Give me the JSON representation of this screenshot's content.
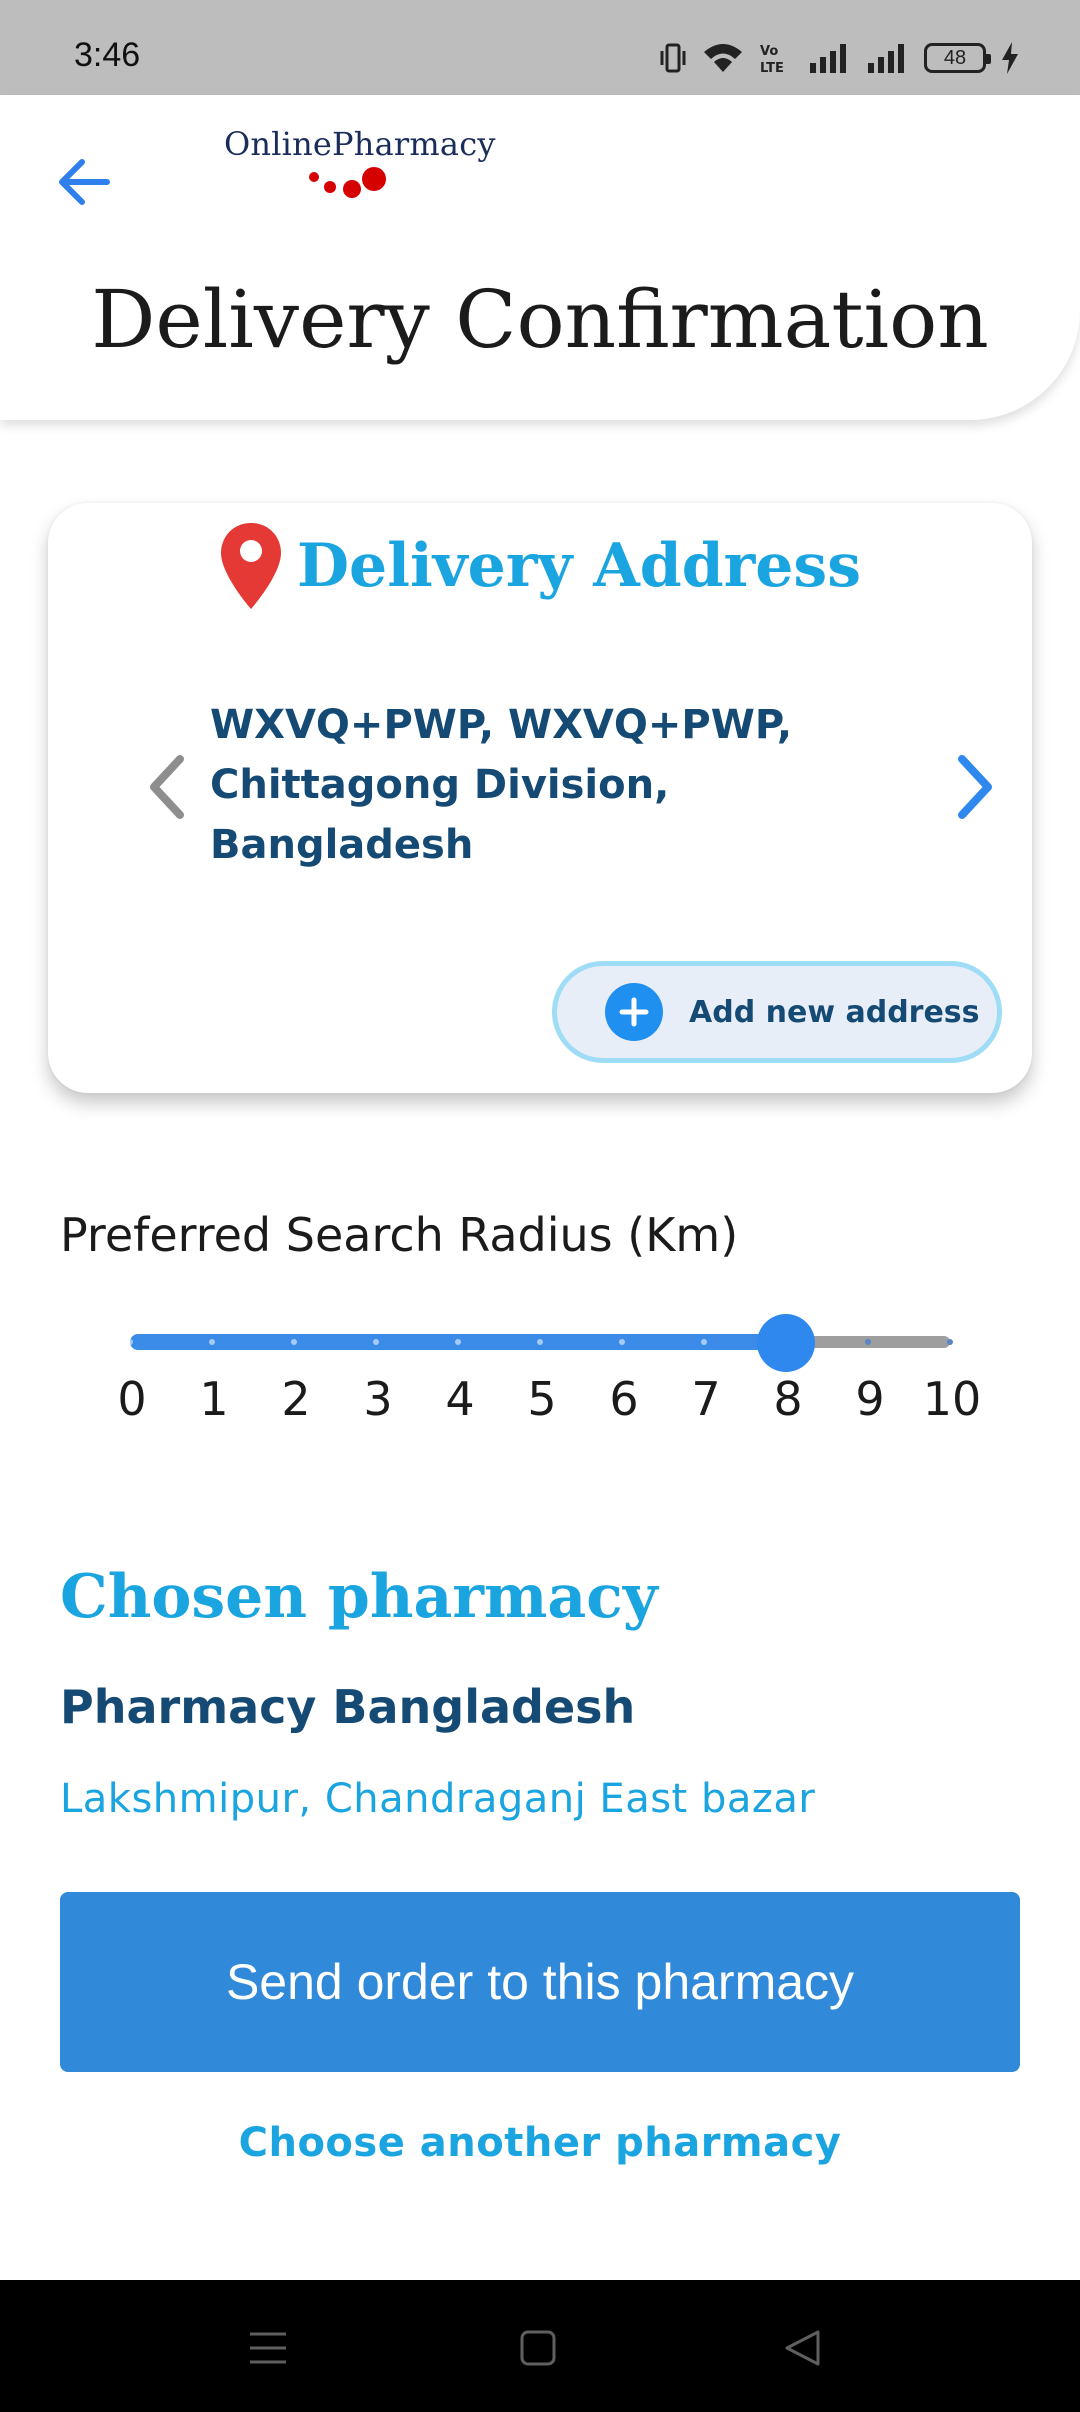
{
  "status_bar": {
    "time": "3:46",
    "battery_level": "48",
    "icons": [
      "vibrate-icon",
      "wifi-icon",
      "volte-icon",
      "signal-icon",
      "signal-icon",
      "battery-icon",
      "charging-icon"
    ]
  },
  "header": {
    "logo_text": "OnlinePharmacy",
    "title": "Delivery Confirmation",
    "back_icon": "arrow-left-icon"
  },
  "address_card": {
    "title": "Delivery Address",
    "pin_icon": "map-pin-icon",
    "address": "WXVQ+PWP, WXVQ+PWP, Chittagong Division, Bangladesh",
    "add_button_label": "Add new address"
  },
  "radius": {
    "label": "Preferred Search Radius (Km)",
    "min": 0,
    "max": 10,
    "value": 8,
    "ticks": [
      "0",
      "1",
      "2",
      "3",
      "4",
      "5",
      "6",
      "7",
      "8",
      "9",
      "10"
    ]
  },
  "pharmacy": {
    "section_title": "Chosen pharmacy",
    "name": "Pharmacy Bangladesh",
    "address": "Lakshmipur, Chandraganj East bazar"
  },
  "actions": {
    "send_label": "Send order to this pharmacy",
    "choose_another_label": "Choose another pharmacy"
  },
  "colors": {
    "accent": "#1aa4e0",
    "primary_button": "#3089d9",
    "dark_text": "#144a73",
    "pin": "#e53935",
    "logo_dots": "#d50000"
  }
}
